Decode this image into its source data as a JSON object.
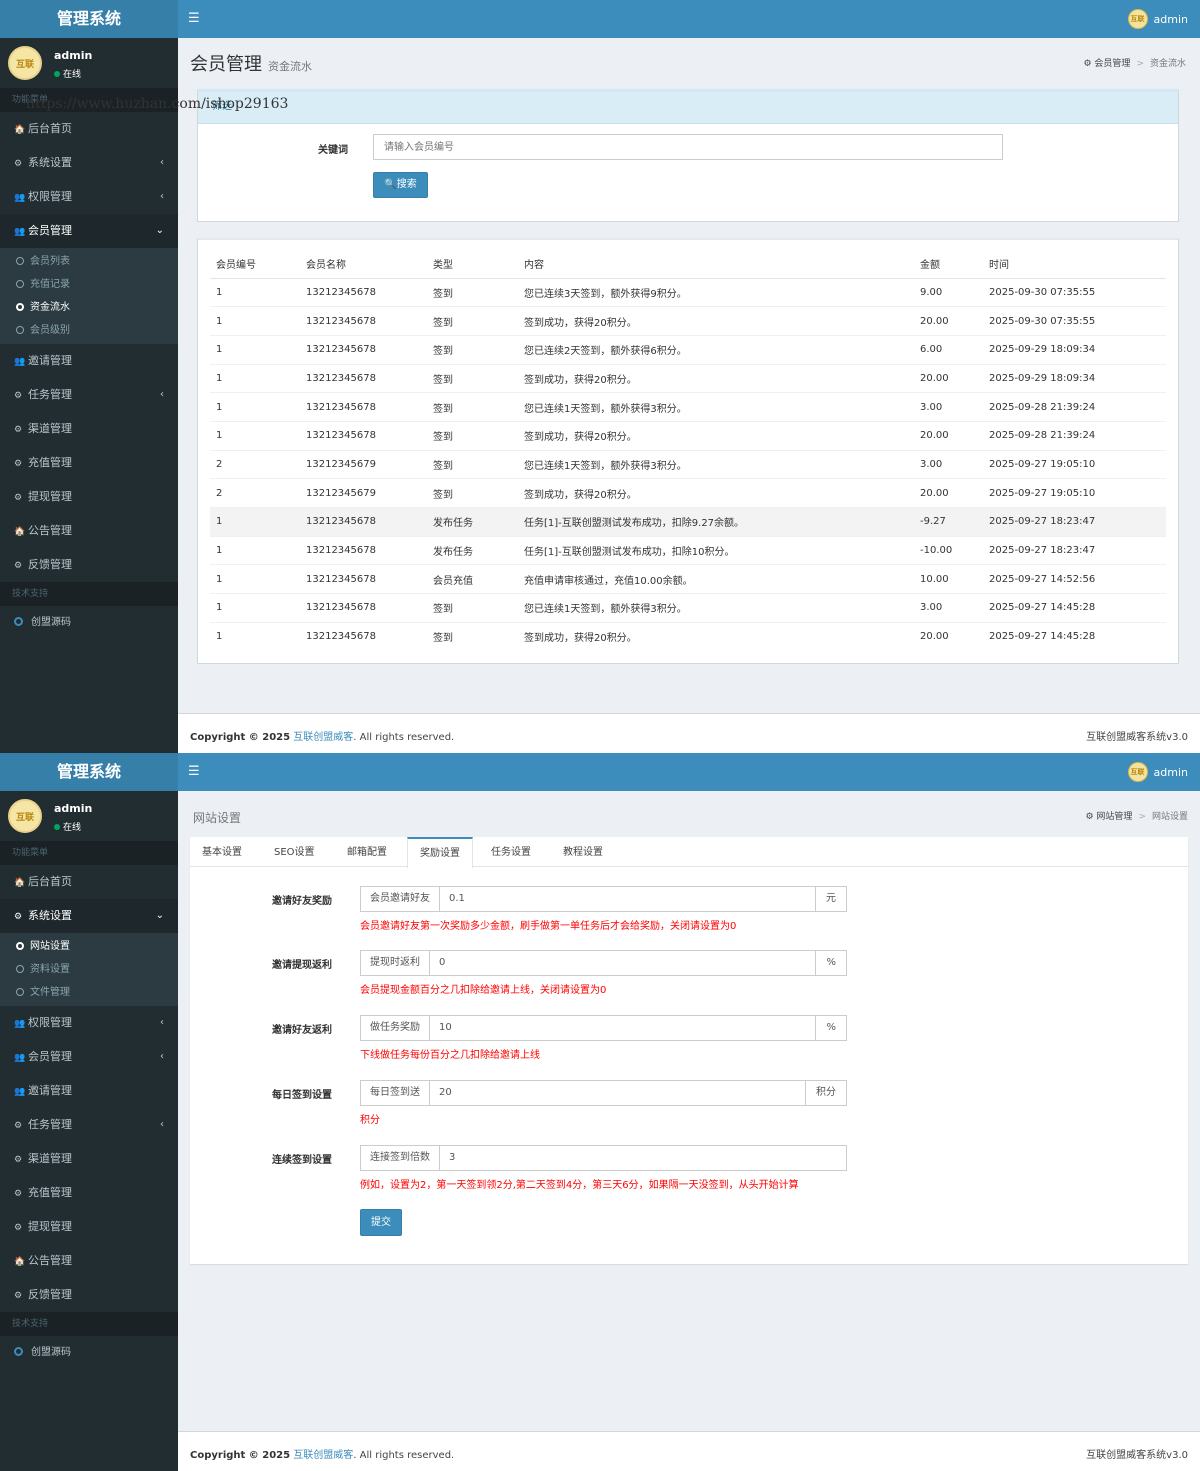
{
  "brand": "管理系统",
  "user": {
    "name": "admin",
    "status": "在线",
    "avatar_text": "互联"
  },
  "screen1": {
    "sidebar": {
      "header": "功能菜单",
      "items": [
        {
          "label": "后台首页",
          "icon": "home-icon"
        },
        {
          "label": "系统设置",
          "icon": "dashboard-icon",
          "arrow": "‹"
        },
        {
          "label": "权限管理",
          "icon": "users-icon",
          "arrow": "‹"
        },
        {
          "label": "会员管理",
          "icon": "users-icon",
          "arrow": "⌄"
        }
      ],
      "sub_items": [
        "会员列表",
        "充值记录",
        "资金流水",
        "会员级别"
      ],
      "items2": [
        {
          "label": "邀请管理",
          "icon": "users-icon"
        },
        {
          "label": "任务管理",
          "icon": "dashboard-icon",
          "arrow": "‹"
        },
        {
          "label": "渠道管理",
          "icon": "dashboard-icon"
        },
        {
          "label": "充值管理",
          "icon": "dashboard-icon"
        },
        {
          "label": "提现管理",
          "icon": "dashboard-icon"
        },
        {
          "label": "公告管理",
          "icon": "home-icon"
        },
        {
          "label": "反馈管理",
          "icon": "dashboard-icon"
        }
      ],
      "support_header": "技术支持",
      "support_item": "创盟源码"
    },
    "title": "会员管理",
    "subtitle": "资金流水",
    "breadcrumb": [
      "会员管理",
      "资金流水"
    ],
    "search_head": "筛选",
    "watermark": "https://www.huzhan.com/ishop29163",
    "keyword_label": "关键词",
    "keyword_placeholder": "请输入会员编号",
    "search_button": "搜索",
    "table": {
      "headers": [
        "会员编号",
        "会员名称",
        "类型",
        "内容",
        "金额",
        "时间"
      ],
      "rows": [
        [
          "1",
          "13212345678",
          "签到",
          "您已连续3天签到，额外获得9积分。",
          "9.00",
          "2025-09-30 07:35:55"
        ],
        [
          "1",
          "13212345678",
          "签到",
          "签到成功，获得20积分。",
          "20.00",
          "2025-09-30 07:35:55"
        ],
        [
          "1",
          "13212345678",
          "签到",
          "您已连续2天签到，额外获得6积分。",
          "6.00",
          "2025-09-29 18:09:34"
        ],
        [
          "1",
          "13212345678",
          "签到",
          "签到成功，获得20积分。",
          "20.00",
          "2025-09-29 18:09:34"
        ],
        [
          "1",
          "13212345678",
          "签到",
          "您已连续1天签到，额外获得3积分。",
          "3.00",
          "2025-09-28 21:39:24"
        ],
        [
          "1",
          "13212345678",
          "签到",
          "签到成功，获得20积分。",
          "20.00",
          "2025-09-28 21:39:24"
        ],
        [
          "2",
          "13212345679",
          "签到",
          "您已连续1天签到，额外获得3积分。",
          "3.00",
          "2025-09-27 19:05:10"
        ],
        [
          "2",
          "13212345679",
          "签到",
          "签到成功，获得20积分。",
          "20.00",
          "2025-09-27 19:05:10"
        ],
        [
          "1",
          "13212345678",
          "发布任务",
          "任务[1]-互联创盟测试发布成功，扣除9.27余额。",
          "-9.27",
          "2025-09-27 18:23:47"
        ],
        [
          "1",
          "13212345678",
          "发布任务",
          "任务[1]-互联创盟测试发布成功，扣除10积分。",
          "-10.00",
          "2025-09-27 18:23:47"
        ],
        [
          "1",
          "13212345678",
          "会员充值",
          "充值申请审核通过，充值10.00余额。",
          "10.00",
          "2025-09-27 14:52:56"
        ],
        [
          "1",
          "13212345678",
          "签到",
          "您已连续1天签到，额外获得3积分。",
          "3.00",
          "2025-09-27 14:45:28"
        ],
        [
          "1",
          "13212345678",
          "签到",
          "签到成功，获得20积分。",
          "20.00",
          "2025-09-27 14:45:28"
        ]
      ]
    }
  },
  "screen2": {
    "sidebar": {
      "header": "功能菜单",
      "items": [
        {
          "label": "后台首页",
          "icon": "home-icon"
        },
        {
          "label": "系统设置",
          "icon": "dashboard-icon",
          "arrow": "⌄"
        }
      ],
      "sub_items": [
        "网站设置",
        "资料设置",
        "文件管理"
      ],
      "items2": [
        {
          "label": "权限管理",
          "icon": "users-icon",
          "arrow": "‹"
        },
        {
          "label": "会员管理",
          "icon": "users-icon",
          "arrow": "‹"
        },
        {
          "label": "邀请管理",
          "icon": "users-icon"
        },
        {
          "label": "任务管理",
          "icon": "dashboard-icon",
          "arrow": "‹"
        },
        {
          "label": "渠道管理",
          "icon": "dashboard-icon"
        },
        {
          "label": "充值管理",
          "icon": "dashboard-icon"
        },
        {
          "label": "提现管理",
          "icon": "dashboard-icon"
        },
        {
          "label": "公告管理",
          "icon": "home-icon"
        },
        {
          "label": "反馈管理",
          "icon": "dashboard-icon"
        }
      ],
      "support_header": "技术支持",
      "support_item": "创盟源码"
    },
    "title": "网站设置",
    "breadcrumb": [
      "网站管理",
      "网站设置"
    ],
    "tabs": [
      "基本设置",
      "SEO设置",
      "邮箱配置",
      "奖励设置",
      "任务设置",
      "教程设置"
    ],
    "active_tab": 3,
    "fields": [
      {
        "label": "邀请好友奖励",
        "addon": "会员邀请好友",
        "value": "0.1",
        "suffix": "元",
        "help": "会员邀请好友第一次奖励多少金额，刷手做第一单任务后才会给奖励，关闭请设置为0"
      },
      {
        "label": "邀请提现返利",
        "addon": "提现时返利",
        "value": "0",
        "suffix": "%",
        "help": "会员提现金额百分之几扣除给邀请上线，关闭请设置为0"
      },
      {
        "label": "邀请好友返利",
        "addon": "做任务奖励",
        "value": "10",
        "suffix": "%",
        "help": "下线做任务每份百分之几扣除给邀请上线"
      },
      {
        "label": "每日签到设置",
        "addon": "每日签到送",
        "value": "20",
        "suffix": "积分",
        "help": "积分"
      },
      {
        "label": "连续签到设置",
        "addon": "连接签到倍数",
        "value": "3",
        "suffix": "",
        "help": "例如，设置为2，第一天签到领2分,第二天签到4分，第三天6分，如果隔一天没签到，从头开始计算"
      }
    ],
    "submit": "提交"
  },
  "footer": {
    "copyright": "Copyright © 2025",
    "company": "互联创盟威客",
    "rights": ". All rights reserved.",
    "version": "互联创盟威客系统v3.0"
  },
  "colors": {
    "primary": "#3c8dbc",
    "sidebar": "#222d32",
    "danger": "#ff0000"
  }
}
